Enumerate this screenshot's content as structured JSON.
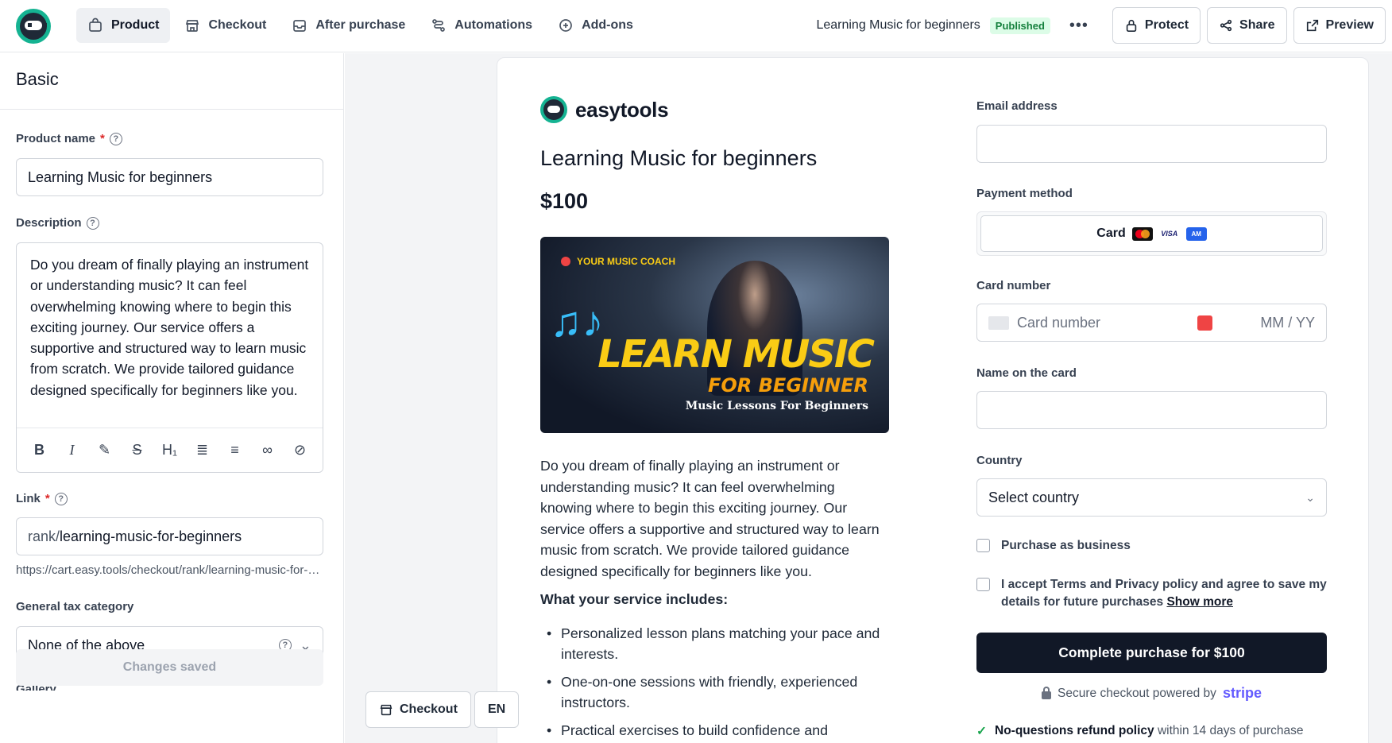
{
  "topbar": {
    "nav": [
      {
        "label": "Product",
        "icon": "bag-icon",
        "active": true
      },
      {
        "label": "Checkout",
        "icon": "store-icon"
      },
      {
        "label": "After purchase",
        "icon": "inbox-icon"
      },
      {
        "label": "Automations",
        "icon": "workflow-icon"
      },
      {
        "label": "Add-ons",
        "icon": "plus-circle-icon"
      }
    ],
    "product_title": "Learning Music for beginners",
    "status_badge": "Published",
    "more": "•••",
    "protect_label": "Protect",
    "share_label": "Share",
    "preview_label": "Preview"
  },
  "left": {
    "section_title": "Basic",
    "product_name_label": "Product name",
    "required_mark": "*",
    "help_mark": "?",
    "product_name_value": "Learning Music for beginners",
    "description_label": "Description",
    "description_text": "Do you dream of finally playing an instrument or understanding music? It can feel overwhelming knowing where to begin this exciting journey. Our service offers a supportive and structured way to learn music from scratch. We provide tailored guidance designed specifically for beginners like you.",
    "link_label": "Link",
    "link_prefix": "rank/",
    "link_value": "learning-music-for-beginners",
    "link_url": "https://cart.easy.tools/checkout/rank/learning-music-for-beginners",
    "tax_label": "General tax category",
    "tax_value": "None of the above",
    "gallery_label": "Gallery",
    "changes_saved": "Changes saved",
    "toolbar": {
      "bold": "B",
      "italic": "I",
      "highlight": "✎",
      "strike": "S",
      "heading": "H₁",
      "ol": "≣",
      "ul": "≡",
      "link": "∞",
      "clear": "⊘"
    }
  },
  "preview": {
    "brand": "easytools",
    "title": "Learning Music for beginners",
    "price": "$100",
    "banner": {
      "coach": "YOUR MUSIC COACH",
      "line1": "LEARN MUSIC",
      "line2": "FOR BEGINNER",
      "line3": "Music Lessons For Beginners",
      "notes": "♫♪"
    },
    "description": "Do you dream of finally playing an instrument or understanding music? It can feel overwhelming knowing where to begin this exciting journey. Our service offers a supportive and structured way to learn music from scratch. We provide tailored guidance designed specifically for beginners like you.",
    "includes_heading": "What your service includes:",
    "includes": [
      "Personalized lesson plans matching your pace and interests.",
      "One-on-one sessions with friendly, experienced instructors.",
      "Practical exercises to build confidence and"
    ],
    "form": {
      "email_label": "Email address",
      "payment_label": "Payment method",
      "card_option": "Card",
      "visa": "VISA",
      "amex": "AM",
      "card_number_label": "Card number",
      "card_number_placeholder": "Card number",
      "expiry_placeholder": "MM / YY",
      "name_label": "Name on the card",
      "country_label": "Country",
      "country_value": "Select country",
      "business_label": "Purchase as business",
      "terms_label": "I accept Terms and Privacy policy and agree to save my details for future purchases",
      "show_more": "Show more",
      "complete_button": "Complete purchase for $100",
      "secure_text": "Secure checkout powered by",
      "stripe": "stripe",
      "refund_bold": "No-questions refund policy",
      "refund_rest": "within 14 days of purchase",
      "tick": "✓"
    },
    "checkout_button": "Checkout",
    "lang_button": "EN"
  },
  "colors": {
    "brand_green": "#15b392",
    "primary_dark": "#111827",
    "published_bg": "#dcfce7",
    "published_text": "#15803d",
    "stripe": "#635bff"
  }
}
